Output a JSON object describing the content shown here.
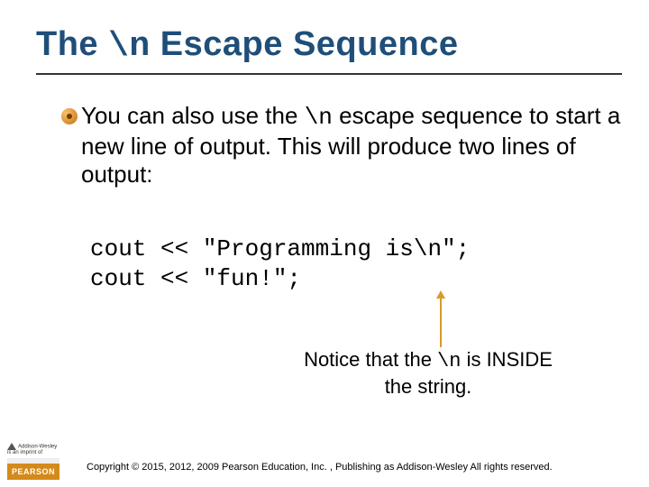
{
  "title": {
    "pre": "The ",
    "code": "\\n",
    "post": " Escape Sequence"
  },
  "bullet": {
    "pre": "You can also use the ",
    "code": "\\n",
    "post": " escape sequence to start a new line of output. This will produce two lines of output:"
  },
  "code": {
    "line1": "cout << \"Programming is\\n\";",
    "line2": "cout << \"fun!\";"
  },
  "annotation": {
    "pre": "Notice that the ",
    "code": "\\n",
    "mid": " is INSIDE",
    "line2": "the string."
  },
  "footer": {
    "aw_line1": "Addison-Wesley",
    "aw_line2": "is an imprint of",
    "pearson": "PEARSON",
    "copyright": "Copyright © 2015, 2012, 2009 Pearson Education, Inc. , Publishing as Addison-Wesley All rights reserved."
  }
}
